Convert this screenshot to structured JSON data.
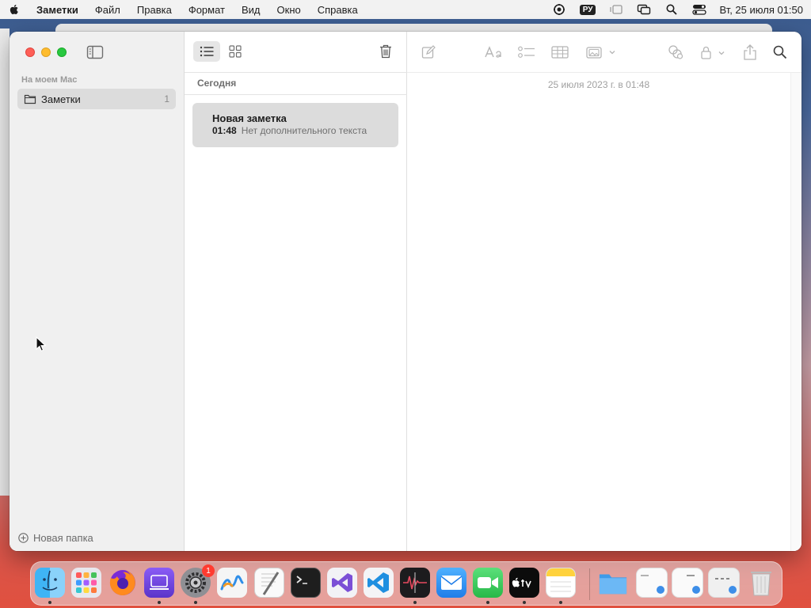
{
  "menubar": {
    "app_name": "Заметки",
    "items": [
      "Файл",
      "Правка",
      "Формат",
      "Вид",
      "Окно",
      "Справка"
    ],
    "input_source": "РУ",
    "clock": "Вт, 25 июля  01:50"
  },
  "sidebar": {
    "section_label": "На моем Mac",
    "folders": [
      {
        "name": "Заметки",
        "count": "1"
      }
    ],
    "new_folder_label": "Новая папка"
  },
  "note_list": {
    "group_label": "Сегодня",
    "notes": [
      {
        "title": "Новая заметка",
        "time": "01:48",
        "preview": "Нет дополнительного текста"
      }
    ]
  },
  "editor": {
    "date": "25 июля 2023 г. в 01:48"
  },
  "dock": {
    "apps": [
      "finder-icon",
      "launchpad-icon",
      "firefox-icon",
      "podcast-capture-icon",
      "system-settings-icon",
      "freeform-icon",
      "textedit-icon",
      "terminal-icon",
      "visual-studio-icon",
      "vscode-icon",
      "instruments-icon",
      "mail-icon",
      "facetime-icon",
      "appletv-icon",
      "notes-icon"
    ],
    "settings_badge": "1"
  },
  "colors": {
    "close": "#fe5f57",
    "minimize": "#febc2e",
    "maximize": "#28c840",
    "selection": "#dcdcdc"
  }
}
